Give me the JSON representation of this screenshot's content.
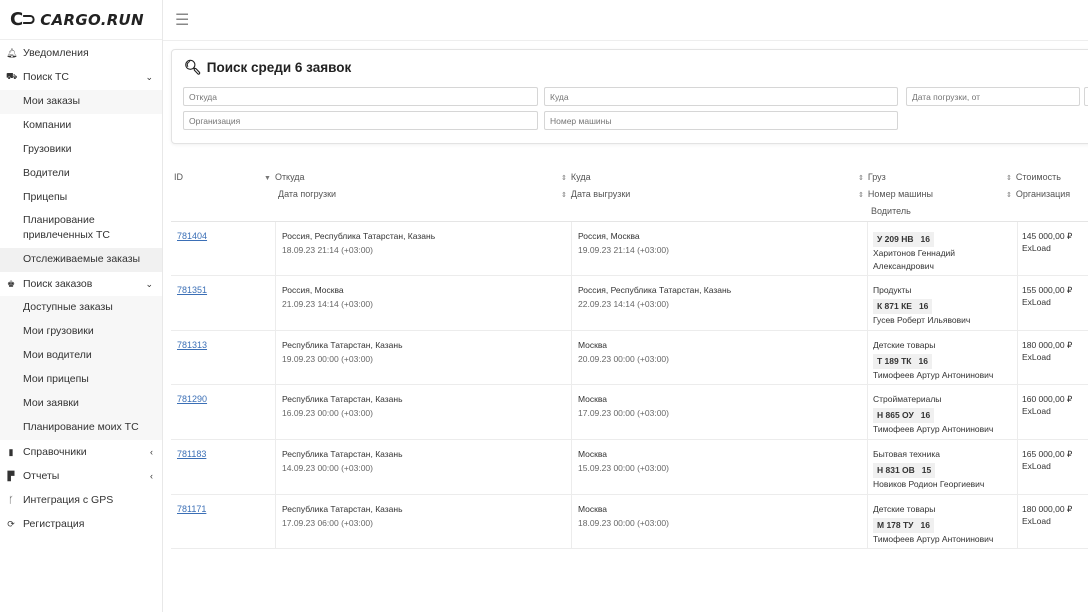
{
  "logo": {
    "mark": "C⊃",
    "text": "CARGO.RUN"
  },
  "menu": {
    "notifications": "Уведомления",
    "search_ts": "Поиск ТС",
    "search_ts_items": [
      "Мои заказы",
      "Компании",
      "Грузовики",
      "Водители",
      "Прицепы",
      "Планирование привлеченных ТС",
      "Отслеживаемые заказы"
    ],
    "search_orders": "Поиск заказов",
    "search_orders_items": [
      "Доступные заказы",
      "Мои грузовики",
      "Мои водители",
      "Мои прицепы",
      "Мои заявки",
      "Планирование моих ТС"
    ],
    "references": "Справочники",
    "reports": "Отчеты",
    "gps": "Интеграция с GPS",
    "registration": "Регистрация"
  },
  "search": {
    "title": "Поиск среди 6 заявок",
    "from_placeholder": "Откуда",
    "to_placeholder": "Куда",
    "date_placeholder": "Дата погрузки, от",
    "org_placeholder": "Организация",
    "truck_placeholder": "Номер машины"
  },
  "table": {
    "headers": {
      "id": "ID",
      "from": "Откуда",
      "load_date": "Дата погрузки",
      "to": "Куда",
      "unload_date": "Дата выгрузки",
      "cargo": "Груз",
      "truck": "Номер машины",
      "driver": "Водитель",
      "cost": "Стоимость",
      "org": "Организация"
    },
    "rows": [
      {
        "id": "781404",
        "from": "Россия, Республика Татарстан, Казань",
        "load_date": "18.09.23 21:14 (+03:00)",
        "to": "Россия, Москва",
        "unload_date": "19.09.23 21:14 (+03:00)",
        "cargo": "",
        "plate": "У 209 НВ",
        "region": "16",
        "driver": "Харитонов Геннадий Александрович",
        "cost": "145 000,00 ₽",
        "org": "ExLoad"
      },
      {
        "id": "781351",
        "from": "Россия, Москва",
        "load_date": "21.09.23 14:14 (+03:00)",
        "to": "Россия, Республика Татарстан, Казань",
        "unload_date": "22.09.23 14:14 (+03:00)",
        "cargo": "Продукты",
        "plate": "К 871 КЕ",
        "region": "16",
        "driver": "Гусев Роберт Ильявович",
        "cost": "155 000,00 ₽",
        "org": "ExLoad"
      },
      {
        "id": "781313",
        "from": "Республика Татарстан, Казань",
        "load_date": "19.09.23 00:00 (+03:00)",
        "to": "Москва",
        "unload_date": "20.09.23 00:00 (+03:00)",
        "cargo": "Детские товары",
        "plate": "Т 189 ТК",
        "region": "16",
        "driver": "Тимофеев Артур Антонинович",
        "cost": "180 000,00 ₽",
        "org": "ExLoad"
      },
      {
        "id": "781290",
        "from": "Республика Татарстан, Казань",
        "load_date": "16.09.23 00:00 (+03:00)",
        "to": "Москва",
        "unload_date": "17.09.23 00:00 (+03:00)",
        "cargo": "Стройматериалы",
        "plate": "Н 865 ОУ",
        "region": "16",
        "driver": "Тимофеев Артур Антонинович",
        "cost": "160 000,00 ₽",
        "org": "ExLoad"
      },
      {
        "id": "781183",
        "from": "Республика Татарстан, Казань",
        "load_date": "14.09.23 00:00 (+03:00)",
        "to": "Москва",
        "unload_date": "15.09.23 00:00 (+03:00)",
        "cargo": "Бытовая техника",
        "plate": "Н 831 ОВ",
        "region": "15",
        "driver": "Новиков Родион Георгиевич",
        "cost": "165 000,00 ₽",
        "org": "ExLoad"
      },
      {
        "id": "781171",
        "from": "Республика Татарстан, Казань",
        "load_date": "17.09.23 06:00 (+03:00)",
        "to": "Москва",
        "unload_date": "18.09.23 00:00 (+03:00)",
        "cargo": "Детские товары",
        "plate": "М 178 ТУ",
        "region": "16",
        "driver": "Тимофеев Артур Антонинович",
        "cost": "180 000,00 ₽",
        "org": "ExLoad"
      }
    ]
  }
}
